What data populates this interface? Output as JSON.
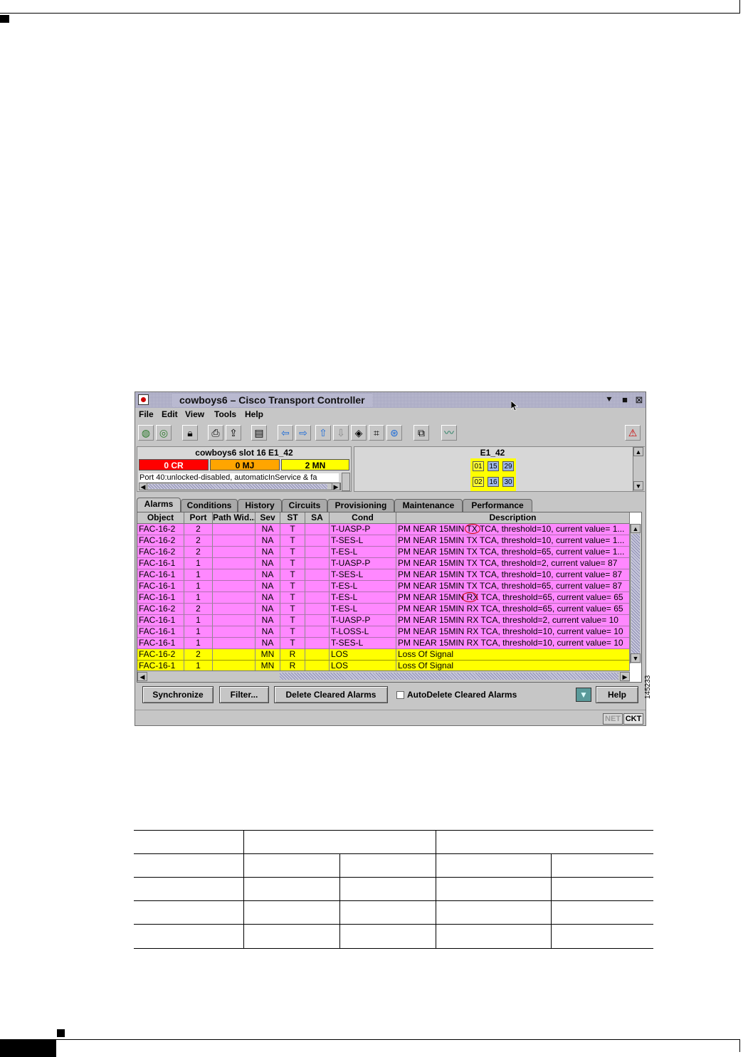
{
  "window": {
    "title": "cowboys6 – Cisco Transport Controller",
    "controls": [
      "minimize",
      "maximize",
      "close"
    ]
  },
  "menu": [
    "File",
    "Edit",
    "View",
    "Tools",
    "Help"
  ],
  "toolbar_icons": [
    "globe-icon",
    "globe-network-icon",
    "lock-icon",
    "print-icon",
    "export-icon",
    "properties-icon",
    "back-arrow-icon",
    "forward-arrow-icon",
    "up-arrow-icon",
    "down-arrow-icon",
    "node-icon",
    "topology-icon",
    "network-icon",
    "span-icon",
    "chart-icon",
    "alarm-warning-icon"
  ],
  "node_panel": {
    "title": "cowboys6 slot 16 E1_42",
    "critical": "0 CR",
    "major": "0 MJ",
    "minor": "2 MN",
    "port_status": "Port 40:unlocked-disabled, automaticInService & fa",
    "colors": {
      "critical": "#ff0000",
      "major": "#ffa500",
      "minor": "#ffff00"
    }
  },
  "card_panel": {
    "title": "E1_42",
    "ports": [
      "01",
      "15",
      "29",
      "02",
      "16",
      "30"
    ]
  },
  "tabs": [
    "Alarms",
    "Conditions",
    "History",
    "Circuits",
    "Provisioning",
    "Maintenance",
    "Performance"
  ],
  "alarms_table": {
    "columns": [
      "Object",
      "Port",
      "Path Wid...",
      "Sev",
      "ST",
      "SA",
      "Cond",
      "Description"
    ],
    "rows": [
      [
        "FAC-16-2",
        "2",
        "",
        "NA",
        "T",
        "",
        "T-UASP-P",
        "PM  NEAR 15MIN TX TCA, threshold=10, current value= 1..."
      ],
      [
        "FAC-16-2",
        "2",
        "",
        "NA",
        "T",
        "",
        "T-SES-L",
        "PM  NEAR 15MIN TX TCA, threshold=10, current value= 1..."
      ],
      [
        "FAC-16-2",
        "2",
        "",
        "NA",
        "T",
        "",
        "T-ES-L",
        "PM  NEAR 15MIN TX TCA, threshold=65, current value= 1..."
      ],
      [
        "FAC-16-1",
        "1",
        "",
        "NA",
        "T",
        "",
        "T-UASP-P",
        "PM  NEAR 15MIN TX TCA, threshold=2, current value= 87"
      ],
      [
        "FAC-16-1",
        "1",
        "",
        "NA",
        "T",
        "",
        "T-SES-L",
        "PM  NEAR 15MIN TX TCA, threshold=10, current value= 87"
      ],
      [
        "FAC-16-1",
        "1",
        "",
        "NA",
        "T",
        "",
        "T-ES-L",
        "PM  NEAR 15MIN TX TCA, threshold=65, current value= 87"
      ],
      [
        "FAC-16-1",
        "1",
        "",
        "NA",
        "T",
        "",
        "T-ES-L",
        "PM  NEAR 15MIN RX TCA, threshold=65, current value= 65"
      ],
      [
        "FAC-16-2",
        "2",
        "",
        "NA",
        "T",
        "",
        "T-ES-L",
        "PM  NEAR 15MIN RX TCA, threshold=65, current value= 65"
      ],
      [
        "FAC-16-1",
        "1",
        "",
        "NA",
        "T",
        "",
        "T-UASP-P",
        "PM  NEAR 15MIN RX TCA, threshold=2, current value= 10"
      ],
      [
        "FAC-16-1",
        "1",
        "",
        "NA",
        "T",
        "",
        "T-LOSS-L",
        "PM  NEAR 15MIN RX TCA, threshold=10, current value= 10"
      ],
      [
        "FAC-16-1",
        "1",
        "",
        "NA",
        "T",
        "",
        "T-SES-L",
        "PM  NEAR 15MIN RX TCA, threshold=10, current value= 10"
      ],
      [
        "FAC-16-2",
        "2",
        "",
        "MN",
        "R",
        "",
        "LOS",
        "Loss Of Signal"
      ],
      [
        "FAC-16-1",
        "1",
        "",
        "MN",
        "R",
        "",
        "LOS",
        "Loss Of Signal"
      ]
    ],
    "row_colors": {
      "NA": "#ff88ff",
      "MN": "#ffff00"
    }
  },
  "buttons": {
    "synchronize": "Synchronize",
    "filter": "Filter...",
    "delete_cleared": "Delete Cleared Alarms",
    "autodelete_label": "AutoDelete Cleared Alarms",
    "help": "Help"
  },
  "status": {
    "net": "NET",
    "ckt": "CKT"
  },
  "figure_id": "145233"
}
